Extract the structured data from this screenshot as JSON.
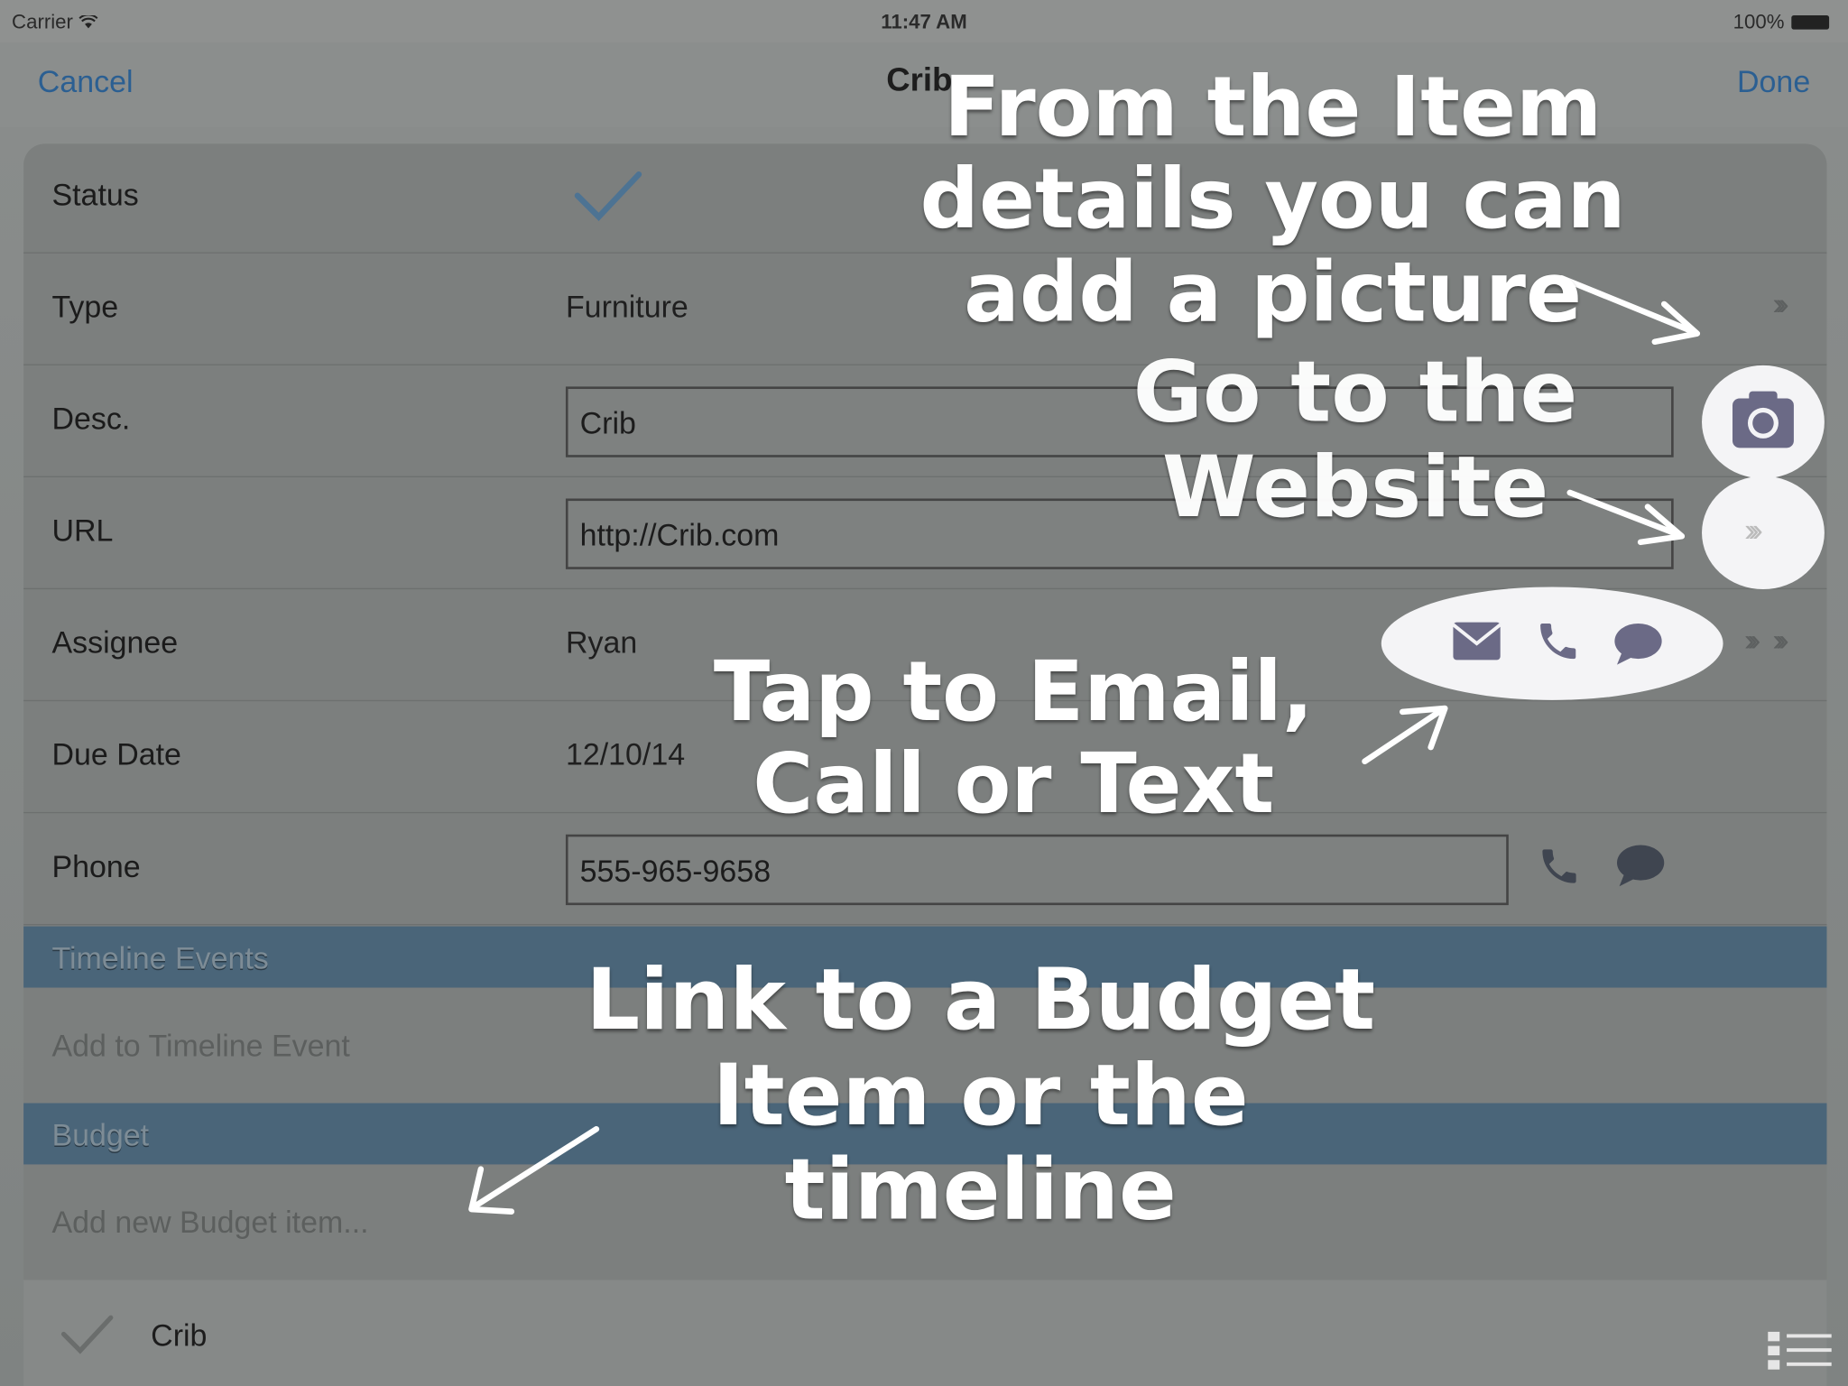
{
  "status_bar": {
    "carrier": "Carrier",
    "time": "11:47 AM",
    "battery": "100%"
  },
  "nav": {
    "cancel": "Cancel",
    "title": "Crib",
    "done": "Done"
  },
  "rows": {
    "status": {
      "label": "Status"
    },
    "type": {
      "label": "Type",
      "value": "Furniture"
    },
    "desc": {
      "label": "Desc.",
      "value": "Crib"
    },
    "url": {
      "label": "URL",
      "value": "http://Crib.com"
    },
    "assignee": {
      "label": "Assignee",
      "value": "Ryan"
    },
    "due_date": {
      "label": "Due Date",
      "value": "12/10/14"
    },
    "phone": {
      "label": "Phone",
      "value": "555-965-9658"
    }
  },
  "sections": {
    "timeline": {
      "header": "Timeline Events",
      "placeholder": "Add to Timeline Event"
    },
    "budget": {
      "header": "Budget",
      "placeholder": "Add new Budget item..."
    }
  },
  "bottom_item": {
    "label": "Crib"
  },
  "annotations": {
    "picture": "From the Item details you can add a picture",
    "website": "Go to the Website",
    "contact": "Tap to Email, Call or Text",
    "link": "Link to a Budget Item or the timeline"
  },
  "colors": {
    "accent": "#2b5f92",
    "section_header": "#4a6579",
    "contact_icon": "#6b6a86"
  },
  "icons": [
    "wifi-icon",
    "battery-icon",
    "checkmark-icon",
    "chevron-right-icon",
    "camera-icon",
    "email-icon",
    "phone-icon",
    "message-icon",
    "list-view-icon"
  ]
}
